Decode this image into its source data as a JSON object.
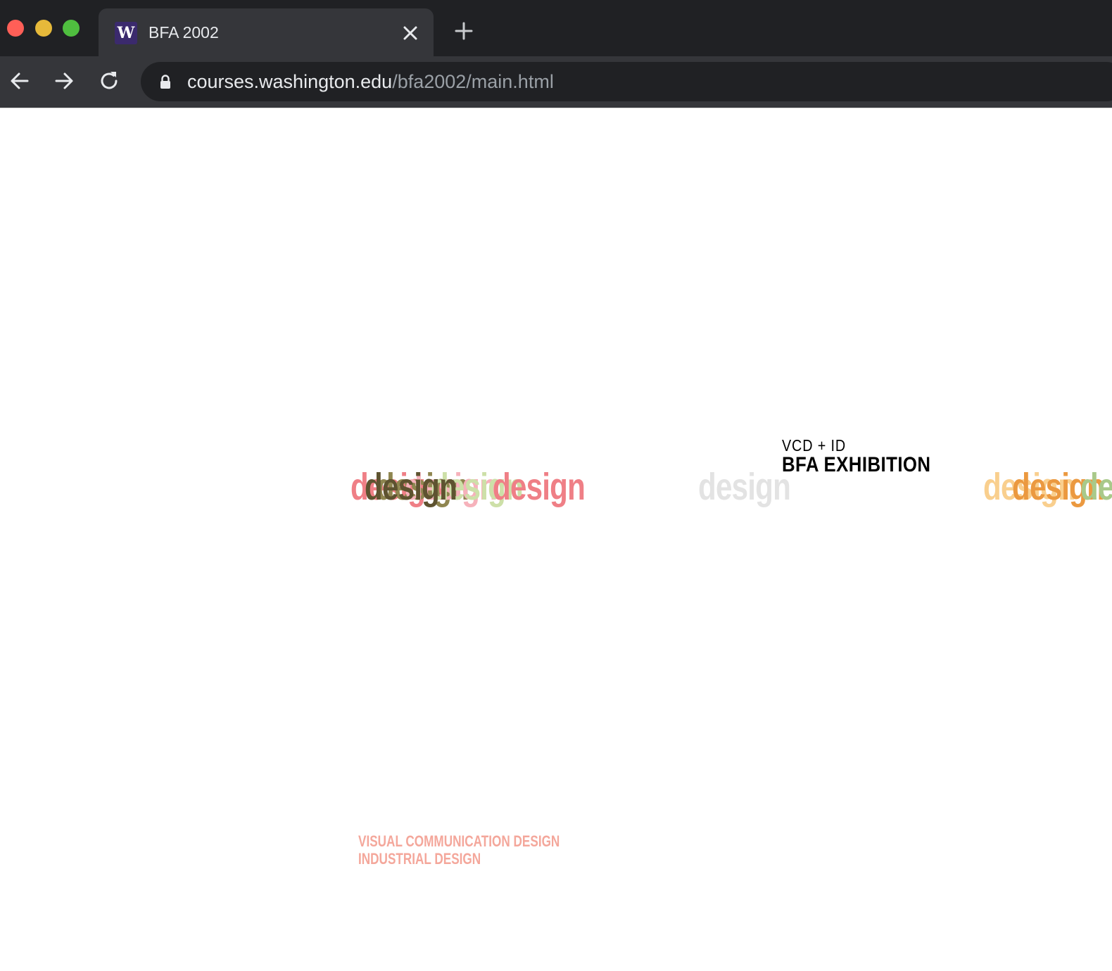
{
  "browser": {
    "tab": {
      "title": "BFA 2002",
      "favicon_letter": "W"
    },
    "address": {
      "host": "courses.washington.edu",
      "path": "/bfa2002/main.html"
    }
  },
  "page": {
    "heading": {
      "line1": "VCD + ID",
      "line2": "BFA EXHIBITION"
    },
    "programs": [
      "VISUAL COMMUNICATION DESIGN",
      "INDUSTRIAL DESIGN"
    ],
    "design_word": "design",
    "design_colors": {
      "pink": "#ef7f86",
      "light_pink": "#f6b2bb",
      "olive": "#8f8650",
      "dark_olive": "#5e5330",
      "light_green": "#cde0a8",
      "gray": "#e3e3e3",
      "orange": "#eb9940",
      "light_orange": "#f9cf8e",
      "green": "#a9c98a"
    }
  }
}
